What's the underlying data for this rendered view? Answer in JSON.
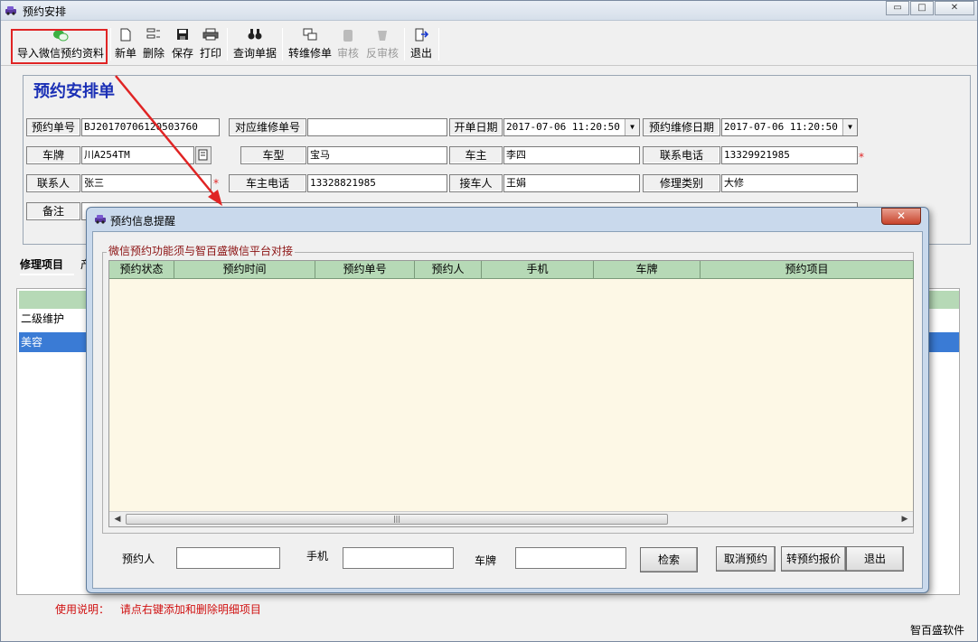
{
  "window": {
    "title": "预约安排",
    "min": "▭",
    "max": "□",
    "close": "✕"
  },
  "toolbar": {
    "import_label": "导入微信预约资料",
    "new_label": "新单",
    "delete_label": "删除",
    "save_label": "保存",
    "print_label": "打印",
    "query_label": "查询单据",
    "convert_label": "转维修单",
    "audit_label": "审核",
    "unaudit_label": "反审核",
    "exit_label": "退出"
  },
  "form": {
    "title": "预约安排单",
    "booking_no_label": "预约单号",
    "booking_no": "BJ20170706120503760",
    "repair_no_label": "对应维修单号",
    "repair_no": "",
    "open_date_label": "开单日期",
    "open_date": "2017-07-06 11:20:50",
    "repair_date_label": "预约维修日期",
    "repair_date": "2017-07-06 11:20:50",
    "plate_label": "车牌",
    "plate": "川A254TM",
    "model_label": "车型",
    "model": "宝马",
    "owner_label": "车主",
    "owner": "李四",
    "phone_label": "联系电话",
    "phone": "13329921985",
    "contact_label": "联系人",
    "contact": "张三",
    "owner_phone_label": "车主电话",
    "owner_phone": "13328821985",
    "receiver_label": "接车人",
    "receiver": "王娟",
    "repair_type_label": "修理类别",
    "repair_type": "大修",
    "remark_label": "备注",
    "required_mark": "*"
  },
  "tabs": {
    "repair_items": "修理项目",
    "parts": "产"
  },
  "grid": {
    "rows": [
      "二级维护",
      "美容"
    ]
  },
  "usage": {
    "label": "使用说明：",
    "text": "请点右键添加和删除明细项目"
  },
  "brand": "智百盛软件",
  "dialog": {
    "title": "预约信息提醒",
    "close": "✕",
    "group_title": "微信预约功能须与智百盛微信平台对接",
    "columns": [
      "预约状态",
      "预约时间",
      "预约单号",
      "预约人",
      "手机",
      "车牌",
      "预约项目"
    ],
    "scroll_grip": "|||",
    "filter": {
      "person_label": "预约人",
      "phone_label": "手机",
      "plate_label": "车牌"
    },
    "buttons": {
      "search": "检索",
      "cancel": "取消预约",
      "quote": "转预约报价",
      "exit": "退出"
    }
  },
  "colors": {
    "accent_red": "#e02424",
    "title_blue": "#1a2fb5",
    "header_green": "#b6d9b6",
    "selected_blue": "#3a7bd5"
  }
}
